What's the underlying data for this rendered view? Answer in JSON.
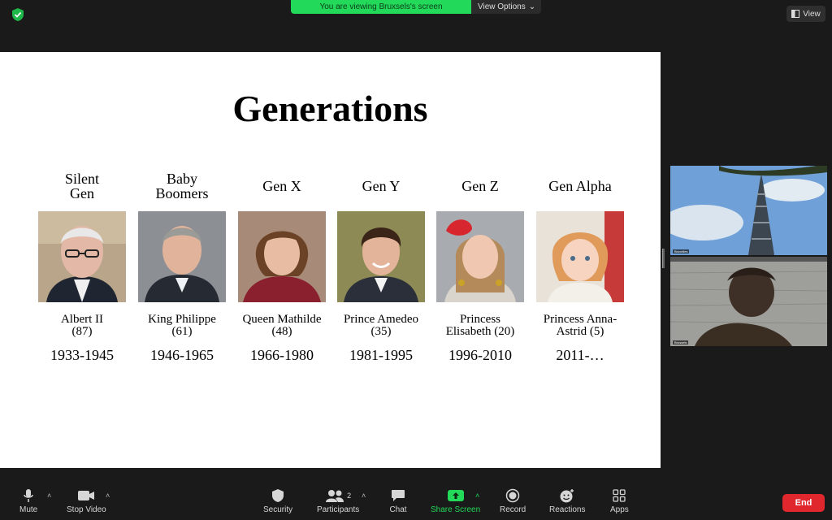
{
  "top": {
    "banner_text": "You are viewing Bruxsels's screen",
    "view_options_label": "View Options",
    "view_label": "View"
  },
  "slide": {
    "title": "Generations",
    "generations": [
      {
        "label": "Silent\nGen",
        "name": "Albert II\n(87)",
        "years": "1933-1945"
      },
      {
        "label": "Baby\nBoomers",
        "name": "King Philippe\n(61)",
        "years": "1946-1965"
      },
      {
        "label": "Gen X",
        "name": "Queen Mathilde\n(48)",
        "years": "1966-1980"
      },
      {
        "label": "Gen Y",
        "name": "Prince Amedeo\n(35)",
        "years": "1981-1995"
      },
      {
        "label": "Gen Z",
        "name": "Princess\nElisabeth (20)",
        "years": "1996-2010"
      },
      {
        "label": "Gen Alpha",
        "name": "Princess Anna-\nAstrid (5)",
        "years": "2011-…"
      }
    ]
  },
  "tiles": {
    "first_name": "Bruxelles",
    "second_name": "Brussels"
  },
  "toolbar": {
    "mute": "Mute",
    "stop_video": "Stop Video",
    "security": "Security",
    "participants": "Participants",
    "participants_count": "2",
    "chat": "Chat",
    "share_screen": "Share Screen",
    "record": "Record",
    "reactions": "Reactions",
    "apps": "Apps",
    "end": "End"
  },
  "colors": {
    "share_green": "#23d959",
    "end_red": "#e0272e",
    "background": "#1a1a1a"
  }
}
